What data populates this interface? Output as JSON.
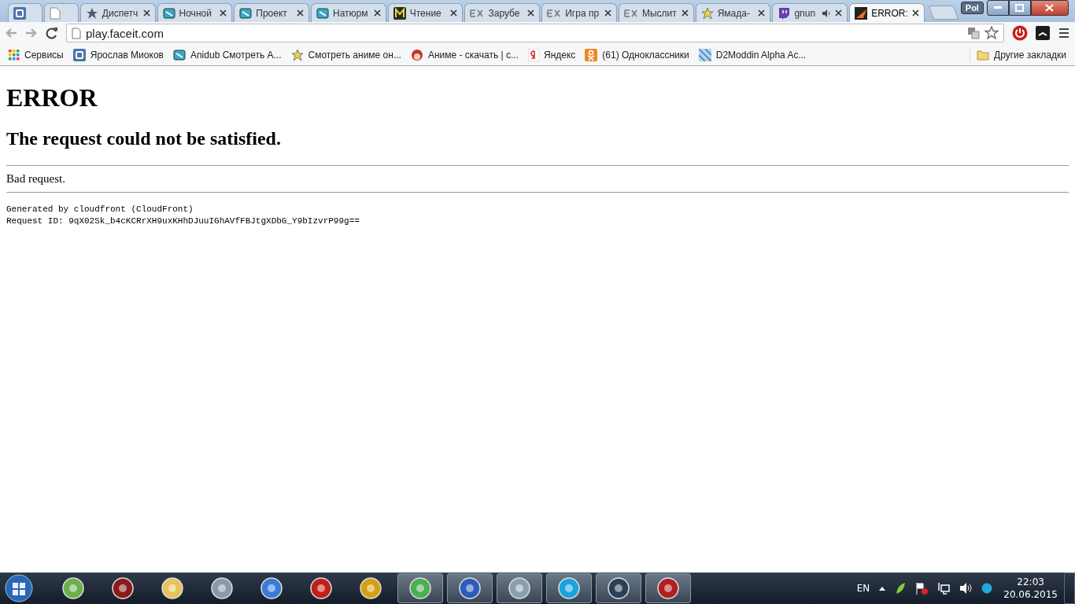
{
  "tabs": [
    {
      "selected": false,
      "audible": false
    },
    {
      "selected": false,
      "audible": false
    },
    {
      "title": "Диспетч",
      "selected": false,
      "audible": false
    },
    {
      "title": "Ночной",
      "selected": false,
      "audible": false
    },
    {
      "title": "Проект",
      "selected": false,
      "audible": false
    },
    {
      "title": "Натюрм",
      "selected": false,
      "audible": false
    },
    {
      "title": "Чтение",
      "selected": false,
      "audible": false
    },
    {
      "title": "Зарубе",
      "selected": false,
      "audible": false
    },
    {
      "title": "Игра пр",
      "selected": false,
      "audible": false
    },
    {
      "title": "Мыслит",
      "selected": false,
      "audible": false
    },
    {
      "title": "Ямада-",
      "selected": false,
      "audible": false
    },
    {
      "title": "gnun",
      "selected": false,
      "audible": true
    },
    {
      "title": "ERROR:",
      "selected": true,
      "audible": false
    }
  ],
  "profile": {
    "label": "Pol"
  },
  "address_bar": {
    "value": "play.faceit.com"
  },
  "bookmarks": [
    {
      "label": "Сервисы"
    },
    {
      "label": "Ярослав Миоков"
    },
    {
      "label": "Anidub Смотреть А..."
    },
    {
      "label": "Смотреть аниме он..."
    },
    {
      "label": "Аниме - скачать | с..."
    },
    {
      "label": "Яндекс"
    },
    {
      "label": "(61) Одноклассники"
    },
    {
      "label": "D2Moddin Alpha Ac..."
    }
  ],
  "other_bookmarks": {
    "label": "Другие закладки"
  },
  "page": {
    "heading": "ERROR",
    "subheading": "The request could not be satisfied.",
    "message": "Bad request.",
    "footer_lines": [
      "Generated by cloudfront (CloudFront)",
      "Request ID: 9qX02Sk_b4cKCRrXH9uxKHhDJuuIGhAVfFBJtgXDbG_Y9bIzvrP99g=="
    ]
  },
  "taskbar": {
    "apps": [
      {
        "running": false
      },
      {
        "running": false
      },
      {
        "running": false
      },
      {
        "running": false
      },
      {
        "running": false
      },
      {
        "running": false
      },
      {
        "running": false
      },
      {
        "running": true
      },
      {
        "running": true
      },
      {
        "running": true
      },
      {
        "running": true
      },
      {
        "running": true
      },
      {
        "running": true
      }
    ],
    "language": "EN",
    "time": "22:03",
    "date": "20.06.2015"
  }
}
